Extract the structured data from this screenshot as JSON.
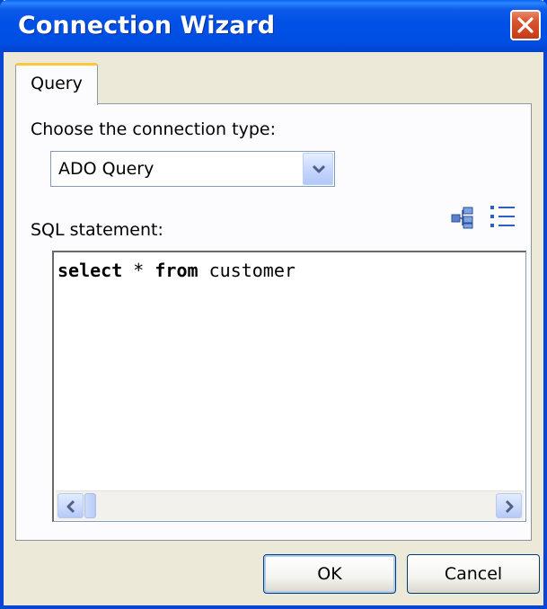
{
  "window": {
    "title": "Connection Wizard",
    "close_icon": "close-icon"
  },
  "tabs": [
    {
      "label": "Query",
      "active": true
    }
  ],
  "query": {
    "connection_type_label": "Choose the connection type:",
    "connection_type": {
      "selected": "ADO Query",
      "icon": "chevron-down-icon"
    },
    "sql_label": "SQL statement:",
    "toolbar": {
      "query_builder_icon": "query-builder-icon",
      "params_icon": "list-icon"
    },
    "sql_statement": {
      "parts": [
        {
          "text": "select",
          "bold": true
        },
        {
          "text": " * ",
          "bold": false
        },
        {
          "text": "from",
          "bold": true
        },
        {
          "text": " customer",
          "bold": false
        }
      ]
    }
  },
  "buttons": {
    "ok": "OK",
    "cancel": "Cancel"
  },
  "colors": {
    "titlebar": "#0050e6",
    "tab_highlight": "#ffc83c",
    "dialog_bg": "#ece9d8"
  }
}
